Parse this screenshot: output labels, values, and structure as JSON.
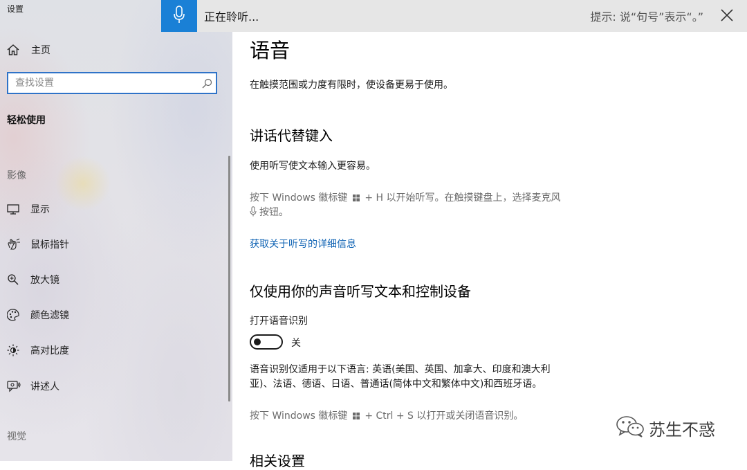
{
  "window": {
    "title": "设置"
  },
  "sidebar": {
    "home_label": "主页",
    "search_placeholder": "查找设置",
    "section_title": "轻松使用",
    "group_vision": "影像",
    "items": [
      {
        "label": "显示",
        "icon": "monitor-icon"
      },
      {
        "label": "鼠标指针",
        "icon": "mouse-pointer-icon"
      },
      {
        "label": "放大镜",
        "icon": "magnifier-icon"
      },
      {
        "label": "颜色滤镜",
        "icon": "color-filter-icon"
      },
      {
        "label": "高对比度",
        "icon": "high-contrast-icon"
      },
      {
        "label": "讲述人",
        "icon": "narrator-icon"
      }
    ],
    "group_hearing": "视觉"
  },
  "dictation": {
    "status": "正在聆听...",
    "hint": "提示: 说“句号”表示“。”"
  },
  "main": {
    "title": "语音",
    "description": "在触摸范围或力度有限时，使设备更易于使用。",
    "dictation_section": {
      "title": "讲话代替键入",
      "subtitle": "使用听写使文本输入更容易。",
      "shortcut_prefix": "按下 Windows 徽标键",
      "shortcut_suffix": "+ H 以开始听写。在触摸键盘上，选择麦克风",
      "shortcut_line2": "按钮。",
      "link": "获取关于听写的详细信息"
    },
    "recognition_section": {
      "title": "仅使用你的声音听写文本和控制设备",
      "toggle_label": "打开语音识别",
      "toggle_state": "关",
      "languages_line1": "语音识别仅适用于以下语言: 英语(美国、英国、加拿大、印度和澳大利",
      "languages_line2": "亚)、法语、德语、日语、普通话(简体中文和繁体中文)和西班牙语。",
      "shortcut_prefix": "按下 Windows 徽标键",
      "shortcut_suffix": "+ Ctrl + S 以打开或关闭语音识别。"
    },
    "related_title": "相关设置"
  },
  "watermark": {
    "text": "苏生不惑"
  },
  "colors": {
    "accent": "#1a80d6",
    "link": "#0f63b4",
    "focus_border": "#2f73c8"
  }
}
